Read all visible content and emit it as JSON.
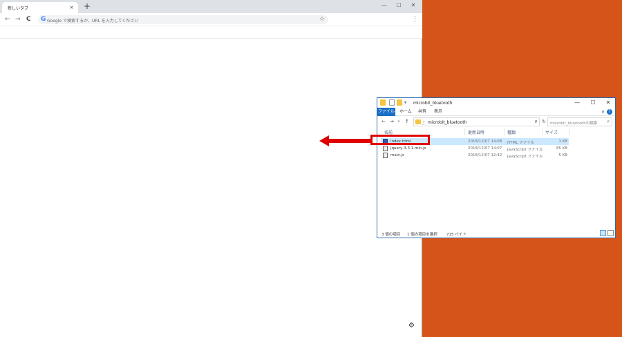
{
  "chrome": {
    "tab_title": "新しいタブ",
    "tab_close": "×",
    "new_tab": "+",
    "minimize": "—",
    "maximize": "☐",
    "close": "✕",
    "back": "←",
    "forward": "→",
    "reload": "C",
    "omnibox_g": "G",
    "omnibox_placeholder": "Google で検索するか、URL を入力してください",
    "bookmark_star": "☆",
    "menu": "⋮",
    "gear": "⚙"
  },
  "explorer": {
    "title": "microbit_bluetooth",
    "minimize": "—",
    "maximize": "☐",
    "close": "✕",
    "ribbon_tabs": [
      "ファイル",
      "ホーム",
      "共有",
      "表示"
    ],
    "ribbon_expand": "∨",
    "help": "?",
    "nav_back": "←",
    "nav_forward": "→",
    "nav_recent": "∨",
    "nav_up": "↑",
    "address_sep": "›",
    "address_path": "microbit_bluetooth",
    "address_dropdown": "∨",
    "refresh": "↻",
    "search_placeholder": "microbit_bluetoothの検索",
    "search_icon": "⌕",
    "columns": [
      "名前",
      "更新日時",
      "種類",
      "サイズ"
    ],
    "sort_caret": "^",
    "files": [
      {
        "name": "index.html",
        "date": "2018/12/07 14:08",
        "type": "HTML ファイル",
        "size": "1 KB",
        "selected": true
      },
      {
        "name": "jquery-3.3.1.min.js",
        "date": "2018/12/07 14:07",
        "type": "JavaScript ファイル",
        "size": "85 KB",
        "selected": false
      },
      {
        "name": "main.js",
        "date": "2018/12/07 12:32",
        "type": "JavaScript ファイル",
        "size": "5 KB",
        "selected": false
      }
    ],
    "status_count": "3 個の項目",
    "status_selected": "1 個の項目を選択",
    "status_size": "715 バイト"
  },
  "colors": {
    "desktop": "#d4541a",
    "accent_red": "#e00000",
    "selection": "#cce8ff",
    "ribbon_file": "#1a6fc7"
  }
}
